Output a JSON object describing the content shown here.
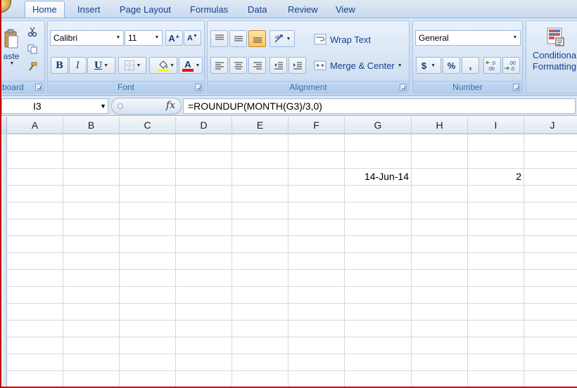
{
  "tabs": [
    {
      "label": "Home"
    },
    {
      "label": "Insert"
    },
    {
      "label": "Page Layout"
    },
    {
      "label": "Formulas"
    },
    {
      "label": "Data"
    },
    {
      "label": "Review"
    },
    {
      "label": "View"
    }
  ],
  "ribbon": {
    "clipboard": {
      "group_label": "board",
      "paste_label": "aste"
    },
    "font": {
      "group_label": "Font",
      "font_name": "Calibri",
      "font_size": "11",
      "bold": "B",
      "italic": "I",
      "underline": "U",
      "highlight_color": "#ffff00",
      "font_color": "#ff0000"
    },
    "alignment": {
      "group_label": "Alignment",
      "wrap_text": "Wrap Text",
      "merge_center": "Merge & Center"
    },
    "number": {
      "group_label": "Number",
      "format": "General",
      "currency": "$",
      "percent": "%",
      "comma": ",",
      "inc_decimal": "←.0 .00",
      "dec_decimal": ".00 →.0"
    },
    "styles": {
      "conditional_line1": "Conditiona",
      "conditional_line2": "Formatting"
    }
  },
  "formula_bar": {
    "name_box": "I3",
    "fx": "fx",
    "formula": "=ROUNDUP(MONTH(G3)/3,0)"
  },
  "grid": {
    "columns": [
      "A",
      "B",
      "C",
      "D",
      "E",
      "F",
      "G",
      "H",
      "I",
      "J"
    ],
    "cells": {
      "G3": "14-Jun-14",
      "I3": "2"
    }
  },
  "colors": {
    "ribbon_text": "#15428b",
    "window_frame": "#c00000"
  }
}
